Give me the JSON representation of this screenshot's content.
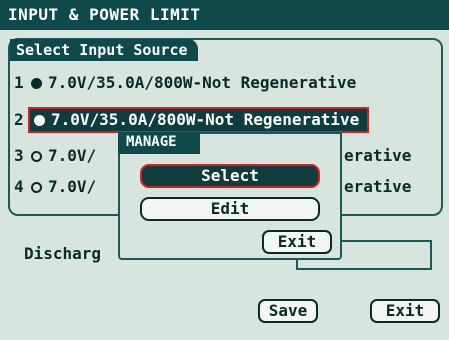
{
  "window": {
    "title": "INPUT & POWER LIMIT"
  },
  "input_source": {
    "group_title": "Select Input Source",
    "rows": [
      {
        "num": "1",
        "label": "7.0V/35.0A/800W-Not Regenerative",
        "checked": true
      },
      {
        "num": "2",
        "label": "7.0V/35.0A/800W-Not Regenerative",
        "checked": false
      },
      {
        "num": "3",
        "label": "7.0V/35.0A/800W-Not Regenerative",
        "visible_prefix": "7.0V/",
        "visible_suffix": "erative",
        "checked": false
      },
      {
        "num": "4",
        "label": "7.0V/35.0A/800W-Not Regenerative",
        "visible_prefix": "7.0V/",
        "visible_suffix": "erative",
        "checked": false
      }
    ]
  },
  "discharge": {
    "label": "Discharg"
  },
  "buttons": {
    "save": "Save",
    "exit": "Exit"
  },
  "manage_dialog": {
    "title": "MANAGE",
    "select_label": "Select",
    "edit_label": "Edit",
    "exit_label": "Exit"
  },
  "colors": {
    "header_bg": "#0f4a4b",
    "screen_bg": "#d8e4de",
    "highlight_border": "#d22020",
    "text": "#0a2a2a"
  }
}
